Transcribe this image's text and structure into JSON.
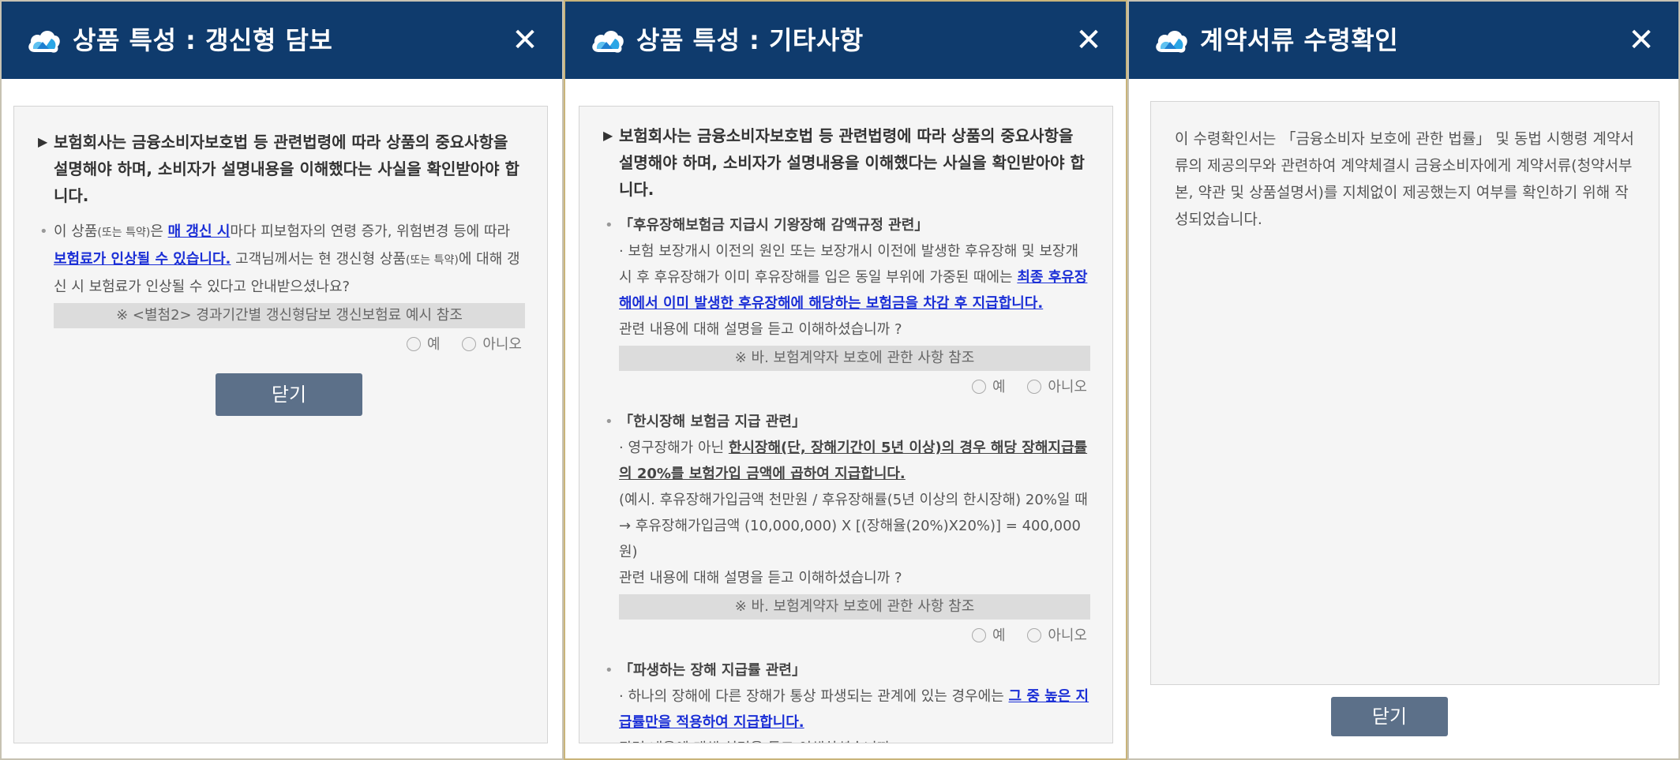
{
  "colors": {
    "header": "#0f3b6d",
    "button": "#5c7089",
    "link": "#1b2fd6"
  },
  "icons": {
    "logo": "cloud-logo-icon",
    "close": "close-icon",
    "bullet": "triangle-bullet-icon"
  },
  "close_glyph": "✕",
  "lead_text": "보험회사는 금융소비자보호법 등 관련법령에 따라 상품의 중요사항을 설명해야 하며, 소비자가 설명내용을 이해했다는 사실을 확인받아야 합니다.",
  "panel1": {
    "title": "상품 특성 : 갱신형 담보",
    "item": {
      "a1": "이 상품",
      "a2": "(또는 특약)",
      "a3": "은 ",
      "link1": "매 갱신 시",
      "a4": "마다 피보험자의 연령 증가, 위험변경 등에 따라 ",
      "link2": "보험료가 인상될 수 있습니다.",
      "a5": " 고객님께서는 현 갱신형 상품",
      "a6": "(또는 특약)",
      "a7": "에 대해 갱신 시 보험료가 인상될 수 있다고 안내받으셨나요?"
    },
    "reference": "※ <별첨2> 경과기간별 갱신형담보 갱신보험료 예시 참조",
    "yes": "예",
    "no": "아니오",
    "close_button": "닫기"
  },
  "panel2": {
    "title": "상품 특성 : 기타사항",
    "items": [
      {
        "head": "「후유장해보험금 지급시 기왕장해 감액규정 관련」",
        "text": "· 보험 보장개시 이전의 원인 또는 보장개시 이전에 발생한 후유장해 및 보장개시 후 후유장해가 이미 후유장해를 입은 동일 부위에 가중된 때에는 ",
        "emph": "최종 후유장해에서 이미 발생한 후유장해에 해당하는 보험금을 차감 후 지급합니다.",
        "question": "관련 내용에 대해 설명을 듣고 이해하셨습니까 ?",
        "reference": "※ 바. 보험계약자 보호에 관한 사항 참조"
      },
      {
        "head": "「한시장해 보험금 지급 관련」",
        "text": "· 영구장해가 아닌 ",
        "emph": "한시장해(단, 장해기간이 5년 이상)의 경우 해당 장해지급률의 20%를 보험가입 금액에 곱하여 지급합니다.",
        "example": "(예시. 후유장해가입금액 천만원 / 후유장해률(5년 이상의 한시장해) 20%일 때 → 후유장해가입금액 (10,000,000) X [(장해율(20%)X20%)] = 400,000원)",
        "question": "관련 내용에 대해 설명을 듣고 이해하셨습니까 ?",
        "reference": "※ 바. 보험계약자 보호에 관한 사항 참조"
      },
      {
        "head": "「파생하는 장해 지급률 관련」",
        "text": "· 하나의 장해에 다른 장해가 통상 파생되는 관계에 있는 경우에는 ",
        "emph": "그 중 높은 지급률만을 적용하여 지급합니다.",
        "question": "관련 내용에 대해 설명을 듣고 이해하셨습니까 ?"
      }
    ],
    "yes": "예",
    "no": "아니오"
  },
  "panel3": {
    "title": "계약서류 수령확인",
    "body": "이 수령확인서는 「금융소비자 보호에 관한 법률」 및 동법 시행령 계약서류의 제공의무와 관련하여 계약체결시 금융소비자에게 계약서류(청약서부본, 약관 및 상품설명서)를 지체없이 제공했는지 여부를 확인하기 위해 작성되었습니다.",
    "close_button": "닫기"
  }
}
